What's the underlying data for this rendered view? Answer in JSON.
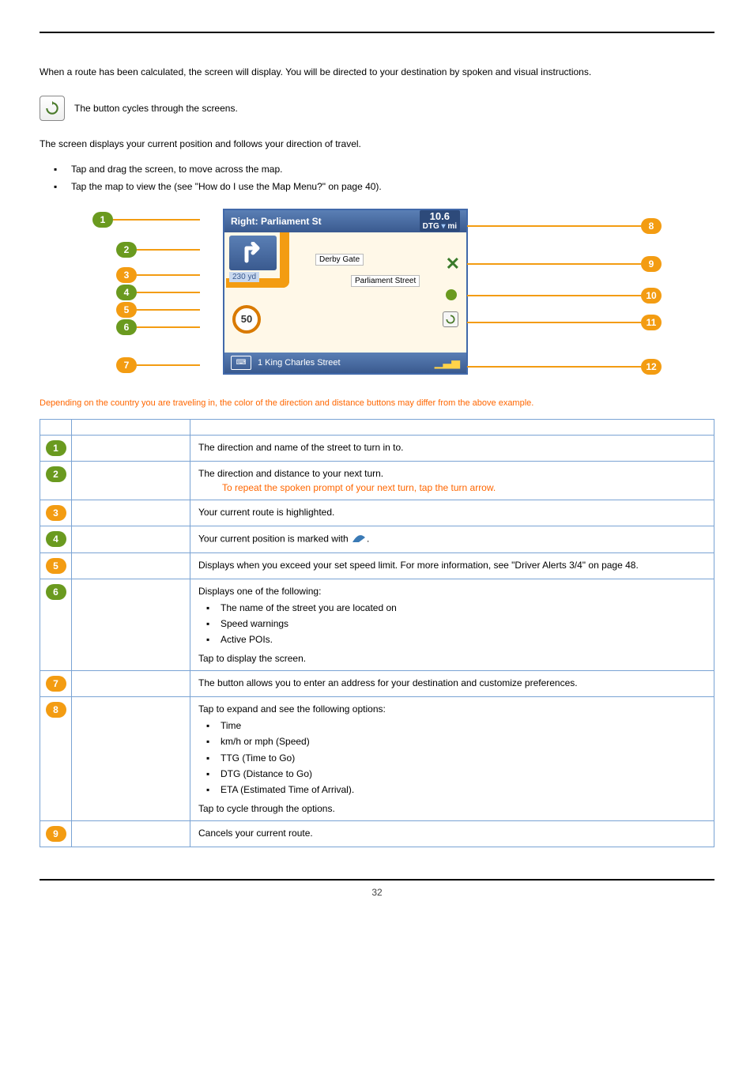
{
  "intro": {
    "line1a": "When a route has been calculated, the ",
    "line1b": " screen will display. You will be directed to your destination by spoken and visual instructions.",
    "cycle_a": "The ",
    "cycle_b": " button cycles through the ",
    "cycle_c": " screens."
  },
  "map_section": {
    "line1a": "The ",
    "line1b": " screen displays your current position and follows your direction of travel.",
    "bullet1": "Tap and drag the screen, to move across the map.",
    "bullet2a": "Tap the map to view the ",
    "bullet2b": " (see \"How do I use the Map Menu?\" on page 40)."
  },
  "map_screenshot": {
    "top_title": "Right: Parliament St",
    "top_distance_value": "10.6",
    "top_distance_unit_prefix": "DTG",
    "top_distance_unit": "mi",
    "turn_distance": "230 yd",
    "label_derby": "Derby Gate",
    "label_parliament": "Parliament Street",
    "speed_limit": "50",
    "bottom_street": "1 King Charles Street"
  },
  "figure_note": "Depending on the country you are traveling in, the color of the direction and distance buttons may differ from the above example.",
  "table": {
    "rows": [
      {
        "num": "1",
        "color": "green",
        "desc": "The direction and name of the street to turn in to."
      },
      {
        "num": "2",
        "color": "green",
        "desc": "The direction and distance to your next turn.",
        "note": "To repeat the spoken prompt of your next turn, tap the turn arrow."
      },
      {
        "num": "3",
        "color": "orange",
        "desc": "Your current route is highlighted."
      },
      {
        "num": "4",
        "color": "green",
        "desc_a": "Your current position is marked with ",
        "desc_b": "."
      },
      {
        "num": "5",
        "color": "orange",
        "desc": "Displays when you exceed your set speed limit. For more information, see \"Driver Alerts 3/4\" on page 48."
      },
      {
        "num": "6",
        "color": "green",
        "desc_intro": "Displays one of the following:",
        "items": [
          "The name of the street you are located on",
          "Speed warnings",
          "Active POIs."
        ],
        "desc_outro_a": "Tap to display the ",
        "desc_outro_b": " screen."
      },
      {
        "num": "7",
        "color": "orange",
        "desc_a": "The ",
        "desc_b": " button allows you to enter an address for your destination and customize preferences."
      },
      {
        "num": "8",
        "color": "orange",
        "desc_intro": " Tap to expand and see the following options:",
        "items": [
          "Time",
          "km/h or mph (Speed)",
          "TTG (Time to Go)",
          "DTG (Distance to Go)",
          "ETA (Estimated Time of Arrival)."
        ],
        "desc_outro": "Tap to cycle through the options."
      },
      {
        "num": "9",
        "color": "orange",
        "desc": "Cancels your current route."
      }
    ]
  },
  "page_number": "32"
}
